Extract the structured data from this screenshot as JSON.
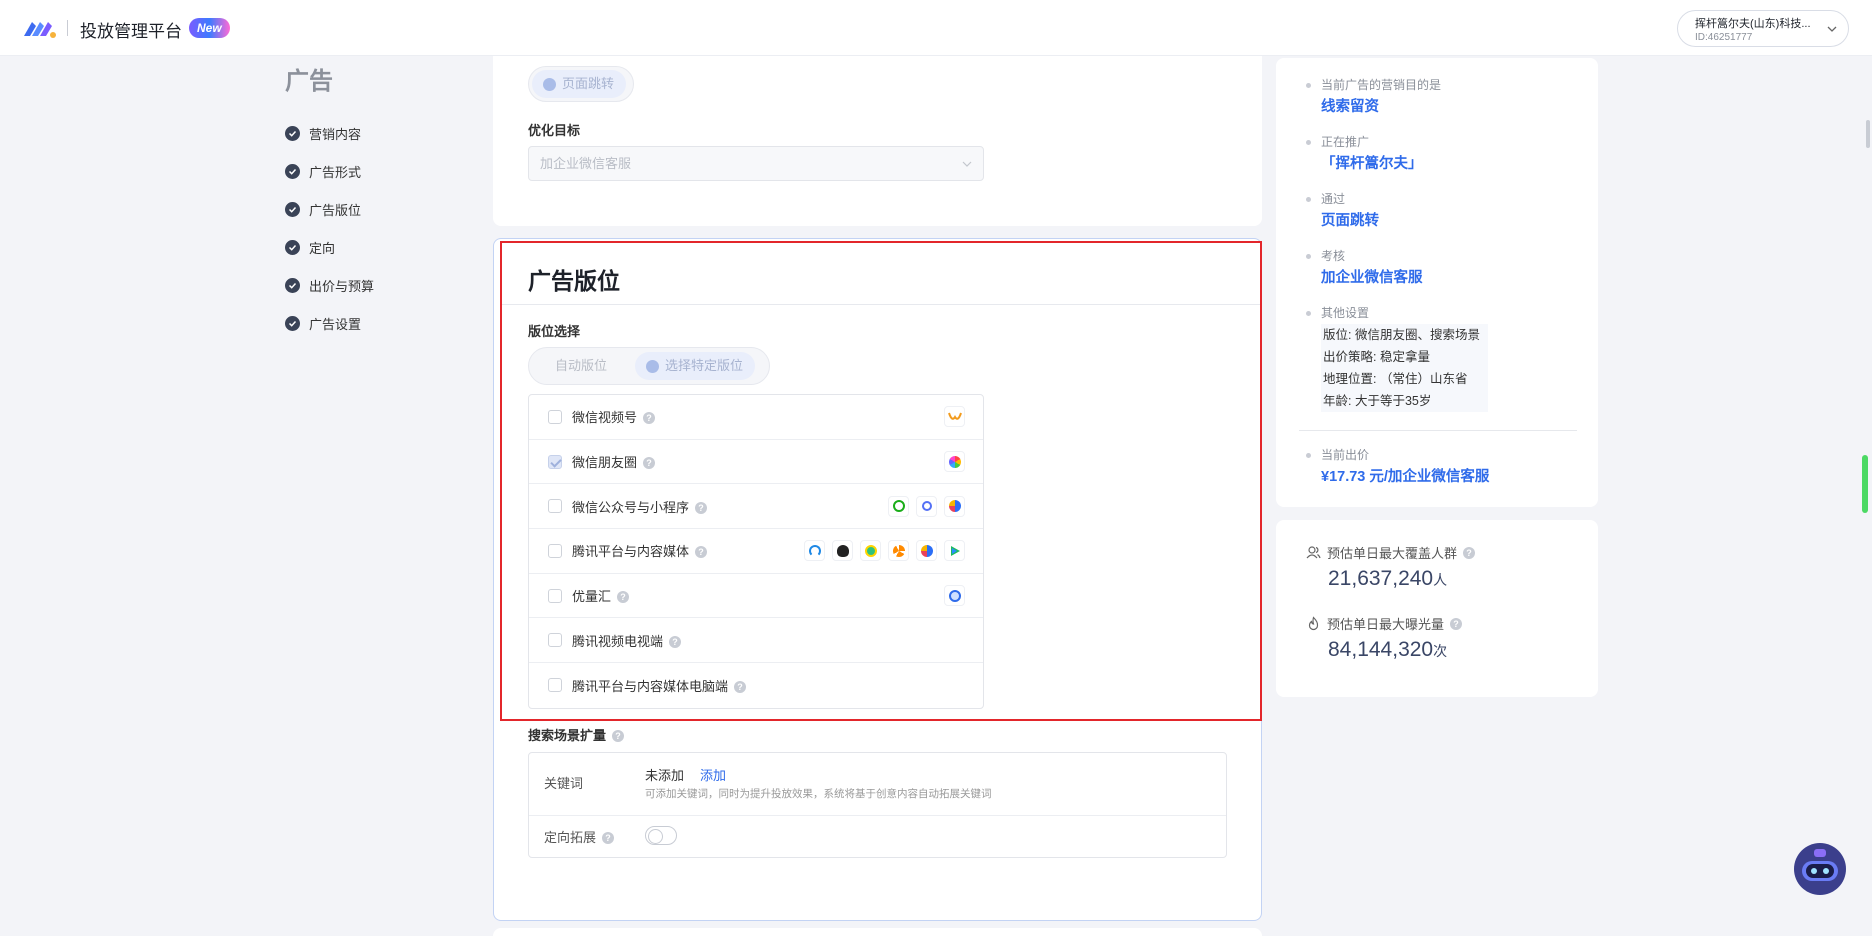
{
  "header": {
    "app_title": "投放管理平台",
    "new_badge": "New",
    "account_name": "挥杆篙尔夫(山东)科技...",
    "account_id": "ID:46251777"
  },
  "sidebar": {
    "title": "广告",
    "items": [
      {
        "label": "营销内容"
      },
      {
        "label": "广告形式"
      },
      {
        "label": "广告版位"
      },
      {
        "label": "定向"
      },
      {
        "label": "出价与预算"
      },
      {
        "label": "广告设置"
      }
    ]
  },
  "top_section": {
    "jump_pill": "页面跳转",
    "opt_label": "优化目标",
    "opt_value": "加企业微信客服"
  },
  "placement": {
    "title": "广告版位",
    "select_label": "版位选择",
    "modes": [
      {
        "label": "自动版位",
        "selected": false
      },
      {
        "label": "选择特定版位",
        "selected": true
      }
    ],
    "items": [
      {
        "label": "微信视频号",
        "checked": false,
        "icons": [
          "video-channel-icon"
        ]
      },
      {
        "label": "微信朋友圈",
        "checked": true,
        "icons": [
          "moments-icon"
        ]
      },
      {
        "label": "微信公众号与小程序",
        "checked": false,
        "icons": [
          "official-account-icon",
          "mini-program-icon",
          "qq-browser-icon"
        ]
      },
      {
        "label": "腾讯平台与内容媒体",
        "checked": false,
        "icons": [
          "tencent-news-icon",
          "qq-icon",
          "qq-music-icon",
          "kandian-icon",
          "qq-browser-icon",
          "tencent-video-icon"
        ]
      },
      {
        "label": "优量汇",
        "checked": false,
        "icons": [
          "youlianghui-icon"
        ]
      },
      {
        "label": "腾讯视频电视端",
        "checked": false,
        "icons": []
      },
      {
        "label": "腾讯平台与内容媒体电脑端",
        "checked": false,
        "icons": []
      }
    ]
  },
  "search_expand": {
    "title": "搜索场景扩量",
    "keyword_label": "关键词",
    "keyword_value": "未添加",
    "keyword_add": "添加",
    "keyword_hint": "可添加关键词，同时为提升投放效果，系统将基于创意内容自动拓展关键词",
    "targeting_label": "定向拓展",
    "targeting_on": false
  },
  "summary": {
    "entries": [
      {
        "label": "当前广告的营销目的是",
        "value": "线索留资"
      },
      {
        "label": "正在推广",
        "value": "「挥杆篙尔夫」"
      },
      {
        "label": "通过",
        "value": "页面跳转"
      },
      {
        "label": "考核",
        "value": "加企业微信客服"
      }
    ],
    "other_label": "其他设置",
    "other_lines": [
      "版位: 微信朋友圈、搜索场景",
      "出价策略: 稳定拿量",
      "地理位置: （常住）山东省",
      "年龄: 大于等于35岁"
    ],
    "bid_label": "当前出价",
    "bid_value": "¥17.73 元/加企业微信客服"
  },
  "estimate": {
    "reach_label": "预估单日最大覆盖人群",
    "reach_value": "21,637,240",
    "reach_unit": "人",
    "exposure_label": "预估单日最大曝光量",
    "exposure_value": "84,144,320",
    "exposure_unit": "次"
  },
  "colors": {
    "accent": "#2f6bea",
    "highlight_border": "#e3262b",
    "nav_check": "#3a4357"
  }
}
